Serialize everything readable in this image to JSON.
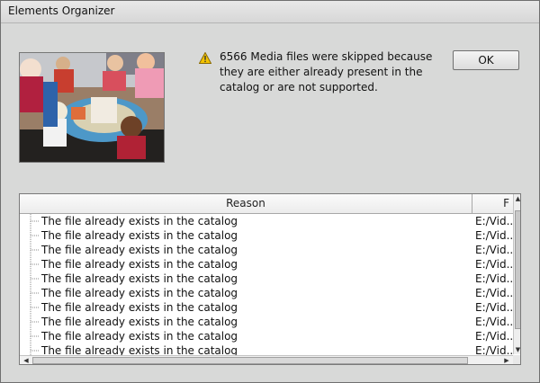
{
  "window": {
    "title": "Elements Organizer"
  },
  "message": {
    "text": "6566 Media files were skipped because they are either already present in the catalog or are not supported."
  },
  "buttons": {
    "ok": "OK"
  },
  "table": {
    "columns": [
      "Reason",
      "F"
    ],
    "rows": [
      [
        "The file already exists in the catalog",
        "E:/Vid..."
      ],
      [
        "The file already exists in the catalog",
        "E:/Vid..."
      ],
      [
        "The file already exists in the catalog",
        "E:/Vid..."
      ],
      [
        "The file already exists in the catalog",
        "E:/Vid..."
      ],
      [
        "The file already exists in the catalog",
        "E:/Vid..."
      ],
      [
        "The file already exists in the catalog",
        "E:/Vid..."
      ],
      [
        "The file already exists in the catalog",
        "E:/Vid..."
      ],
      [
        "The file already exists in the catalog",
        "E:/Vid..."
      ],
      [
        "The file already exists in the catalog",
        "E:/Vid..."
      ],
      [
        "The file already exists in the catalog",
        "E:/Vid..."
      ]
    ]
  },
  "icons": {
    "warning": "warning-icon",
    "preview": "preview-thumbnail"
  },
  "colors": {
    "dialog_bg": "#d8d9d8",
    "list_bg": "#ffffff",
    "warning": "#f3c300"
  }
}
